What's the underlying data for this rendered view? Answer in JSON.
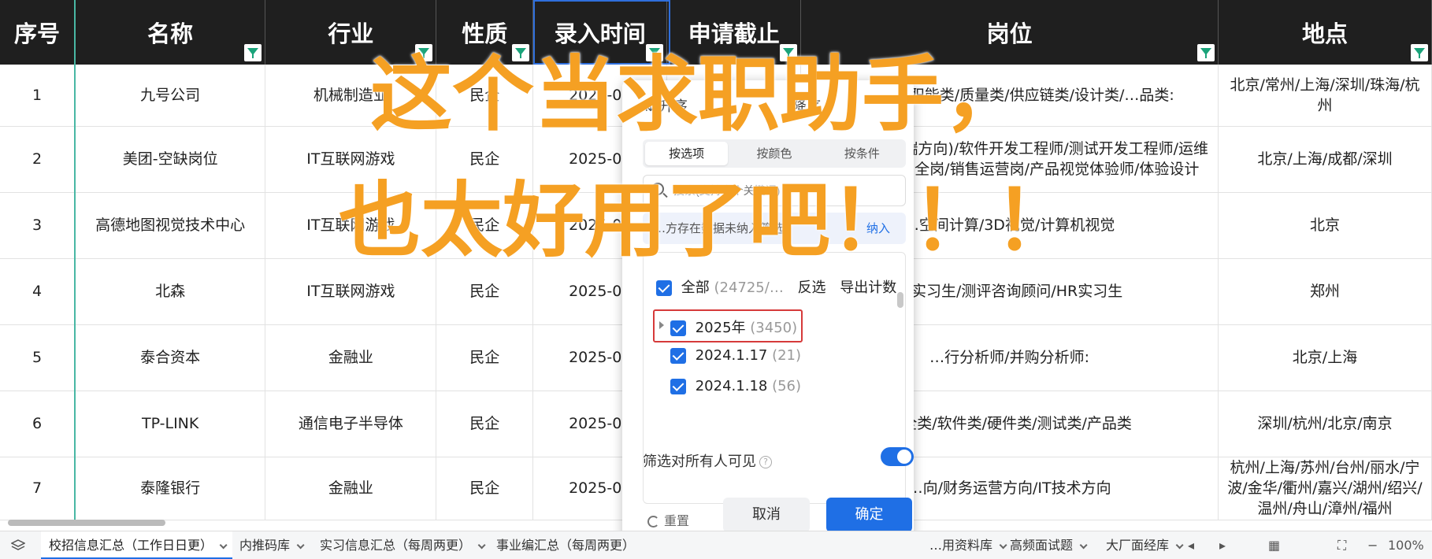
{
  "columns": [
    {
      "label": "序号",
      "filter": false
    },
    {
      "label": "名称",
      "filter": true
    },
    {
      "label": "行业",
      "filter": true
    },
    {
      "label": "性质",
      "filter": true
    },
    {
      "label": "录入时间",
      "filter": true
    },
    {
      "label": "申请截止",
      "filter": true
    },
    {
      "label": "岗位",
      "filter": true
    },
    {
      "label": "地点",
      "filter": true
    }
  ],
  "rows": [
    [
      "1",
      "九号公司",
      "机械制造业",
      "民企",
      "2025-04",
      "",
      "…营…类/职能类/质量类/供应链类/设计类/…品类:",
      "北京/常州/上海/深圳/珠海/杭州"
    ],
    [
      "2",
      "美团-空缺岗位",
      "IT互联网游戏",
      "民企",
      "2025-04",
      "",
      "…(前端&移动端方向)/软件开发工程师/测试开发工程师/运维开发工程师/安全岗/销售运营岗/产品视觉体验师/体验设计",
      "北京/上海/成都/深圳"
    ],
    [
      "3",
      "高德地图视觉技术中心",
      "IT互联网游戏",
      "民企",
      "2025-04",
      "",
      "…空间计算/3D视觉/计算机视觉",
      "北京"
    ],
    [
      "4",
      "北森",
      "IT互联网游戏",
      "民企",
      "2025-04",
      "",
      "…实习生/测评咨询顾问/HR实习生",
      "郑州"
    ],
    [
      "5",
      "泰合资本",
      "金融业",
      "民企",
      "2025-04",
      "",
      "…行分析师/并购分析师:",
      "北京/上海"
    ],
    [
      "6",
      "TP-LINK",
      "通信电子半导体",
      "民企",
      "2025-04",
      "",
      "…全类/软件类/硬件类/测试类/产品类",
      "深圳/杭州/北京/南京"
    ],
    [
      "7",
      "泰隆银行",
      "金融业",
      "民企",
      "2025-04",
      "",
      "…向/财务运营方向/IT技术方向",
      "杭州/上海/苏州/台州/丽水/宁波/金华/衢州/嘉兴/湖州/绍兴/温州/舟山/漳州/福州"
    ]
  ],
  "filter": {
    "sort_asc": "升序",
    "sort_desc": "降序",
    "tabs": [
      "按选项",
      "按颜色",
      "按条件"
    ],
    "search_placeholder": "搜索(支持多个关键词)",
    "notice_text": "…方存在数据未纳入筛选",
    "notice_link": "纳入",
    "all_label": "全部",
    "all_count": "(24725/…",
    "invert_label": "反选",
    "export_label": "导出计数",
    "items": [
      {
        "label": "2025年",
        "count": "(3450)"
      },
      {
        "label": "2024.1.17",
        "count": "(21)"
      },
      {
        "label": "2024.1.18",
        "count": "(56)"
      }
    ],
    "visible_label": "筛选对所有人可见",
    "reset_label": "重置",
    "cancel_label": "取消",
    "ok_label": "确定",
    "toggle_on": true
  },
  "overlay": {
    "line1": "这个当求职助手，",
    "line2": "也太好用了吧！！！",
    "color": "#f5a023"
  },
  "sheet_tabs": [
    "校招信息汇总（工作日日更）",
    "内推码库",
    "实习信息汇总（每周两更）",
    "事业编汇总（每周两更）",
    "…用资料库",
    "高频面试题",
    "大厂面经库"
  ],
  "zoom": "100%",
  "colors": {
    "accent": "#1f6fe5",
    "header_bg": "#1f1f1f",
    "filter_icon": "#1aa37a",
    "highlight": "#d63a3a"
  }
}
